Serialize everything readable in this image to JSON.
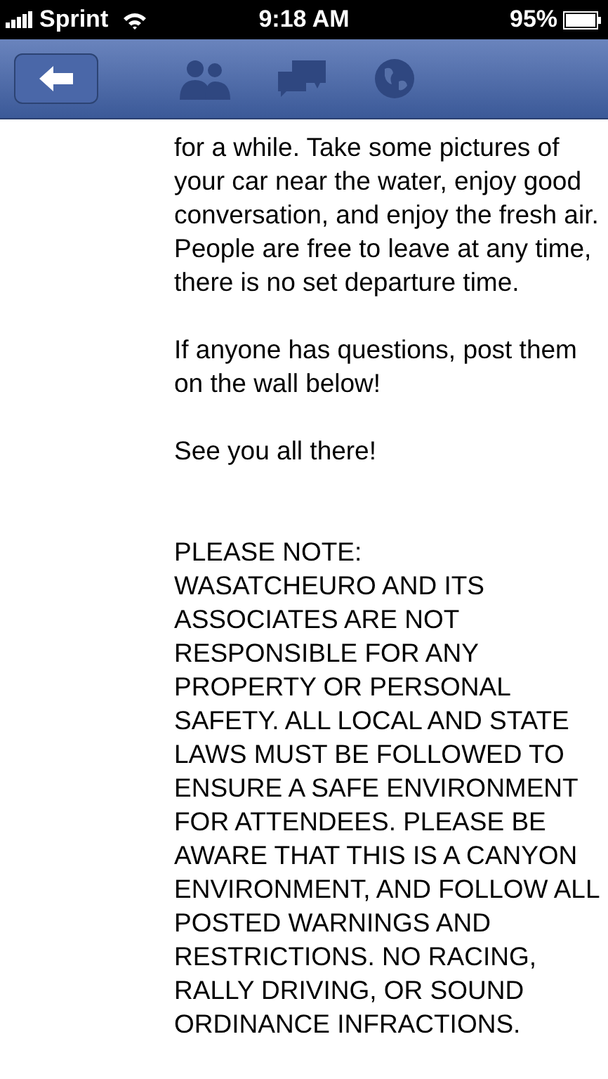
{
  "status_bar": {
    "carrier": "Sprint",
    "time": "9:18 AM",
    "battery": "95%"
  },
  "paragraphs": [
    "for a while. Take some pictures of your car near the water, enjoy good conversation, and enjoy the fresh air. People are free to leave at any time, there is no set departure time.",
    "If anyone has questions, post them on the wall below!",
    "See you all there!"
  ],
  "notice": {
    "heading": "PLEASE NOTE:",
    "body": "WASATCHEURO AND ITS ASSOCIATES ARE NOT RESPONSIBLE FOR ANY PROPERTY OR PERSONAL SAFETY. ALL LOCAL AND STATE LAWS MUST BE FOLLOWED TO ENSURE A SAFE ENVIRONMENT FOR ATTENDEES. PLEASE BE AWARE THAT THIS IS A CANYON ENVIRONMENT, AND FOLLOW ALL POSTED WARNINGS AND RESTRICTIONS. NO RACING, RALLY DRIVING, OR SOUND ORDINANCE INFRACTIONS."
  }
}
